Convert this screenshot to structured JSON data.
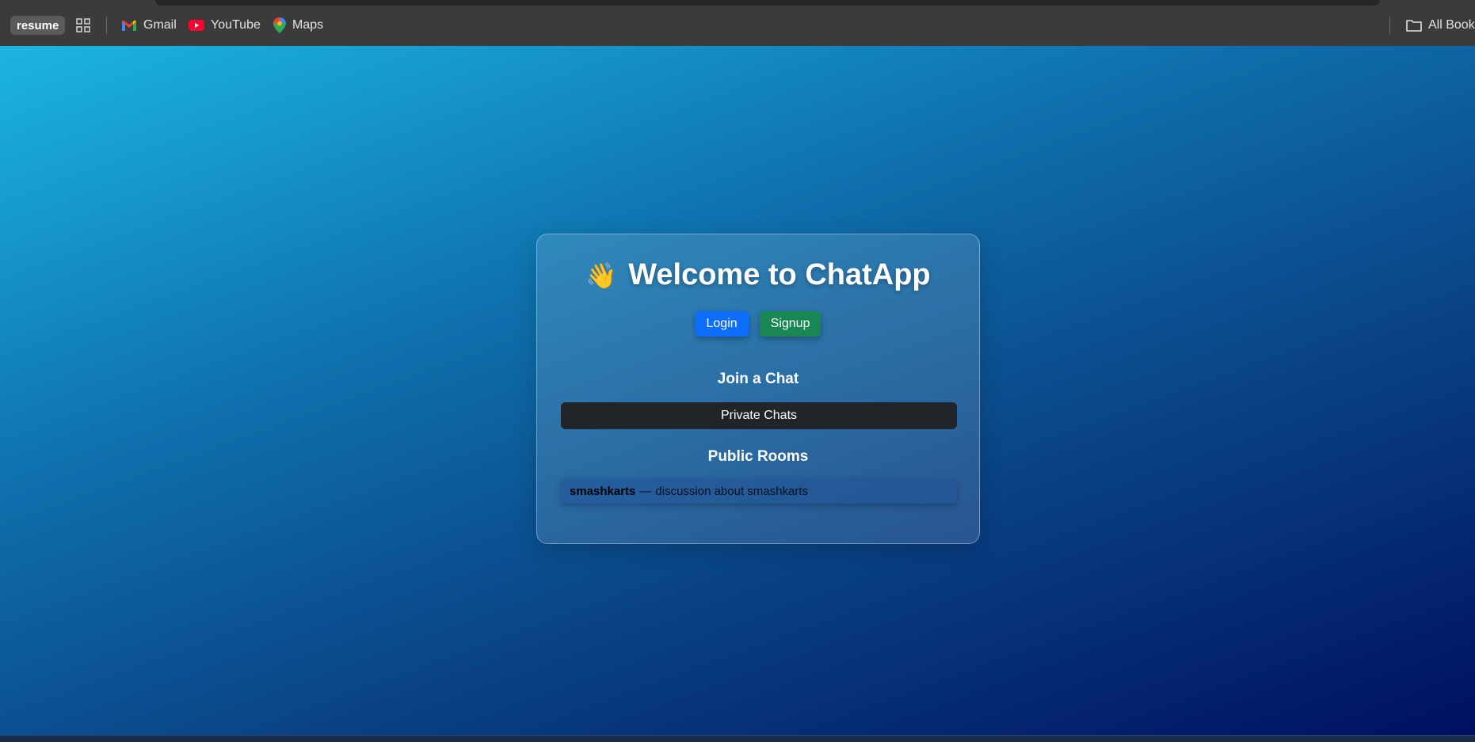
{
  "browser": {
    "profile_chip": "resume",
    "bookmarks": [
      {
        "label": "Gmail",
        "icon": "gmail-icon"
      },
      {
        "label": "YouTube",
        "icon": "youtube-icon"
      },
      {
        "label": "Maps",
        "icon": "maps-icon"
      }
    ],
    "all_bookmarks_label": "All Bookm"
  },
  "card": {
    "wave": "👋",
    "title": "Welcome to ChatApp",
    "login_label": "Login",
    "signup_label": "Signup",
    "join_heading": "Join a Chat",
    "private_chats_label": "Private Chats",
    "public_heading": "Public Rooms",
    "rooms": [
      {
        "name": "smashkarts",
        "dash": "—",
        "description": "discussion about smashkarts"
      }
    ]
  },
  "colors": {
    "login": "#0d6efd",
    "signup": "#198754",
    "private_button": "#212529",
    "gradient_start": "#1cb5e0",
    "gradient_end": "#001060"
  }
}
